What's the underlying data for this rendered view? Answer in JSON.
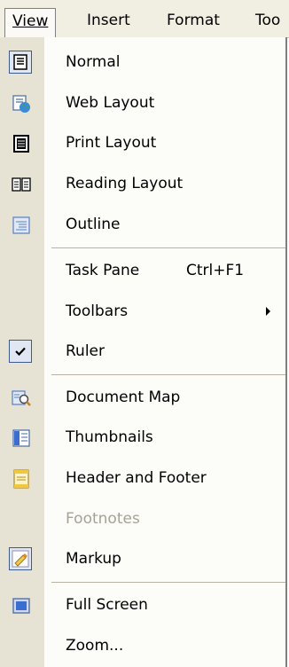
{
  "menubar": {
    "items": [
      {
        "label": "View",
        "active": true
      },
      {
        "label": "Insert"
      },
      {
        "label": "Format"
      },
      {
        "label": "Too"
      }
    ]
  },
  "menu": {
    "items": [
      {
        "label": "Normal",
        "icon": "normal-view-icon",
        "checked": true
      },
      {
        "label": "Web Layout",
        "icon": "web-layout-icon"
      },
      {
        "label": "Print Layout",
        "icon": "print-layout-icon"
      },
      {
        "label": "Reading Layout",
        "icon": "reading-layout-icon"
      },
      {
        "label": "Outline",
        "icon": "outline-icon"
      },
      {
        "label": "Task Pane",
        "shortcut": "Ctrl+F1"
      },
      {
        "label": "Toolbars",
        "submenu": true
      },
      {
        "label": "Ruler",
        "icon": "checkmark-icon",
        "checked": true
      },
      {
        "label": "Document Map",
        "icon": "document-map-icon"
      },
      {
        "label": "Thumbnails",
        "icon": "thumbnails-icon"
      },
      {
        "label": "Header and Footer",
        "icon": "header-footer-icon"
      },
      {
        "label": "Footnotes",
        "disabled": true
      },
      {
        "label": "Markup",
        "icon": "markup-icon",
        "checked": true
      },
      {
        "label": "Full Screen",
        "icon": "full-screen-icon"
      },
      {
        "label": "Zoom..."
      }
    ]
  },
  "colors": {
    "gutter": "#e6e3d4",
    "menu_bg": "#fcfcf9",
    "disabled_text": "#a6a394",
    "check_frame": "#3d5a8a"
  }
}
